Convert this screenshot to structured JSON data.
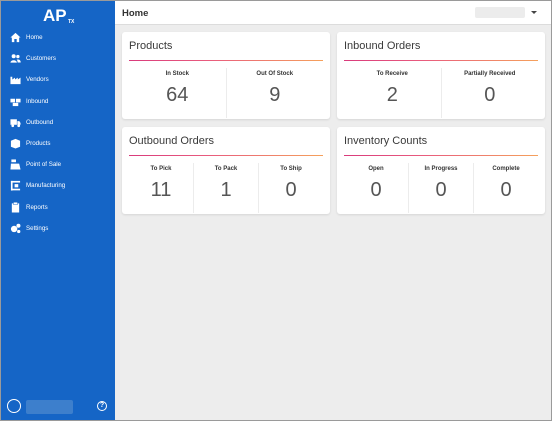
{
  "app": {
    "logo_text": "AP",
    "logo_sub": "TX"
  },
  "header": {
    "title": "Home"
  },
  "sidebar": {
    "items": [
      {
        "label": "Home",
        "icon": "home-icon"
      },
      {
        "label": "Customers",
        "icon": "users-icon"
      },
      {
        "label": "Vendors",
        "icon": "factory-icon"
      },
      {
        "label": "Inbound",
        "icon": "boxes-icon"
      },
      {
        "label": "Outbound",
        "icon": "truck-icon"
      },
      {
        "label": "Products",
        "icon": "box-icon"
      },
      {
        "label": "Point of Sale",
        "icon": "cash-register-icon"
      },
      {
        "label": "Manufacturing",
        "icon": "pallet-icon"
      },
      {
        "label": "Reports",
        "icon": "clipboard-icon"
      },
      {
        "label": "Settings",
        "icon": "gears-icon"
      }
    ],
    "help_glyph": "?"
  },
  "cards": {
    "products": {
      "title": "Products",
      "stats": [
        {
          "label": "In Stock",
          "value": "64"
        },
        {
          "label": "Out Of Stock",
          "value": "9"
        }
      ]
    },
    "inbound": {
      "title": "Inbound Orders",
      "stats": [
        {
          "label": "To Receive",
          "value": "2"
        },
        {
          "label": "Partially Received",
          "value": "0"
        }
      ]
    },
    "outbound": {
      "title": "Outbound Orders",
      "stats": [
        {
          "label": "To Pick",
          "value": "11"
        },
        {
          "label": "To Pack",
          "value": "1"
        },
        {
          "label": "To Ship",
          "value": "0"
        }
      ]
    },
    "inventory": {
      "title": "Inventory Counts",
      "stats": [
        {
          "label": "Open",
          "value": "0"
        },
        {
          "label": "In Progress",
          "value": "0"
        },
        {
          "label": "Complete",
          "value": "0"
        }
      ]
    }
  },
  "colors": {
    "sidebar": "#1565c6",
    "accent_start": "#d93b7c",
    "accent_end": "#f5a15c",
    "background": "#ededed"
  }
}
